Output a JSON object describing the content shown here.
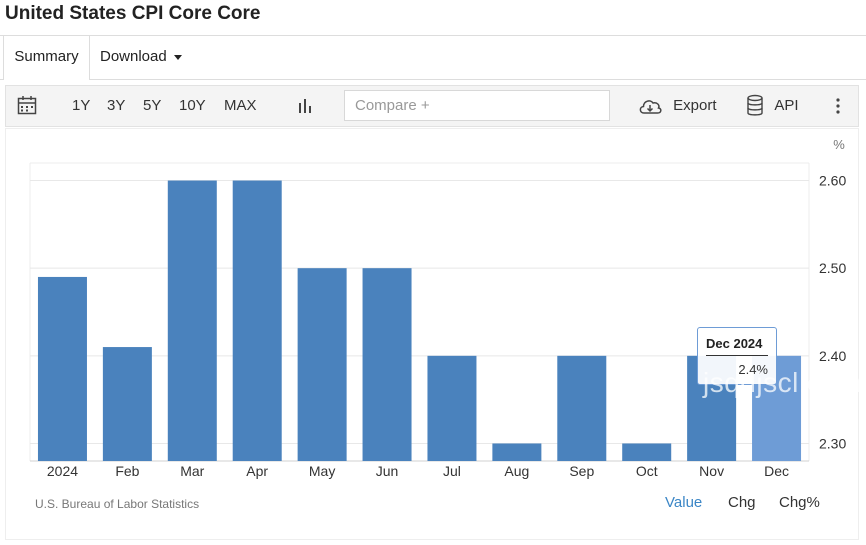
{
  "page": {
    "title": "United States CPI Core Core"
  },
  "tabs": [
    {
      "label": "Summary"
    },
    {
      "label": "Download"
    }
  ],
  "toolbar": {
    "ranges": [
      "1Y",
      "3Y",
      "5Y",
      "10Y",
      "MAX"
    ],
    "compare_placeholder": "Compare +",
    "export_label": "Export",
    "api_label": "API"
  },
  "chart_data": {
    "type": "bar",
    "categories": [
      "2024",
      "Feb",
      "Mar",
      "Apr",
      "May",
      "Jun",
      "Jul",
      "Aug",
      "Sep",
      "Oct",
      "Nov",
      "Dec"
    ],
    "values": [
      2.49,
      2.41,
      2.6,
      2.6,
      2.5,
      2.5,
      2.4,
      2.3,
      2.4,
      2.3,
      2.4,
      2.4
    ],
    "unit": "%",
    "ylim": [
      2.28,
      2.62
    ],
    "yticks": [
      2.3,
      2.4,
      2.5,
      2.6
    ],
    "ytick_labels": [
      "2.30",
      "2.40",
      "2.50",
      "2.60"
    ],
    "grid": true,
    "bar_color": "#4a82bd",
    "highlight_color": "#6e9cd6",
    "highlight_index": 11,
    "tooltip": {
      "title": "Dec 2024",
      "value": "2.4%"
    }
  },
  "footer": {
    "source": "U.S. Bureau of Labor Statistics",
    "modes": [
      "Value",
      "Chg",
      "Chg%"
    ]
  },
  "watermark": "jsqdjscl.com",
  "colors": {
    "accent": "#3b86c6"
  }
}
